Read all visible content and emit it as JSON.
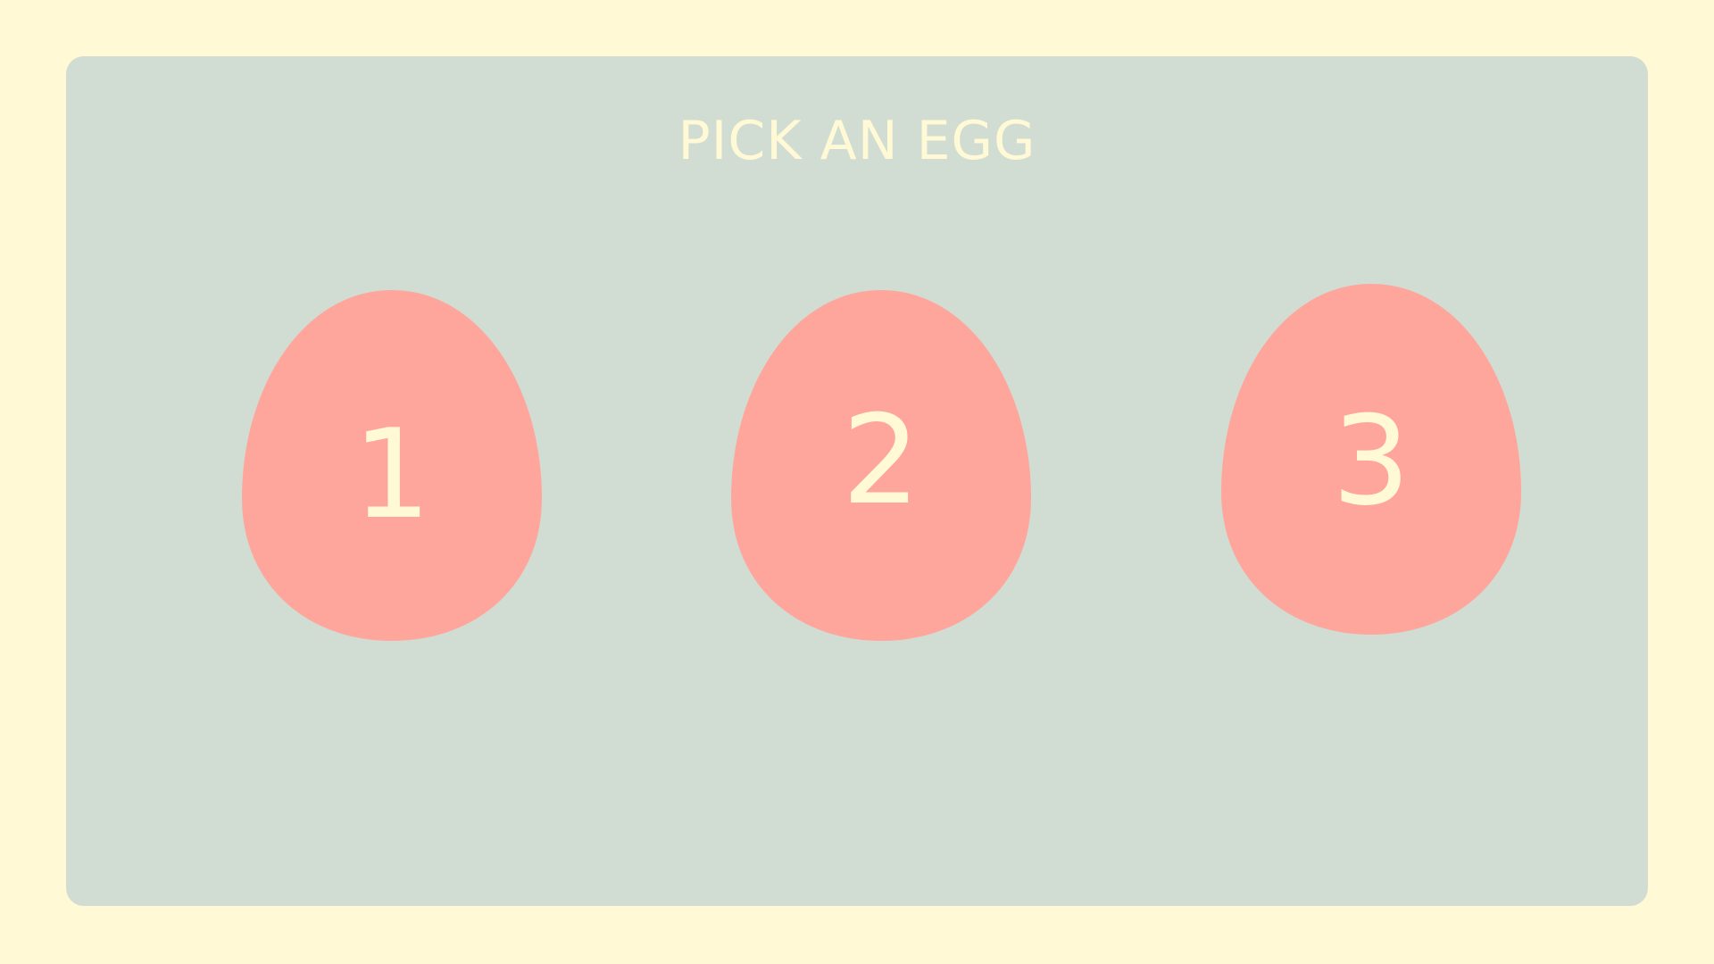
{
  "game": {
    "title": "PICK AN EGG",
    "eggs": [
      {
        "label": "1"
      },
      {
        "label": "2"
      },
      {
        "label": "3"
      }
    ]
  },
  "colors": {
    "background": "#fff9d6",
    "panel": "#d1ddd3",
    "egg": "#ffa69c",
    "text": "#fff9d6"
  }
}
